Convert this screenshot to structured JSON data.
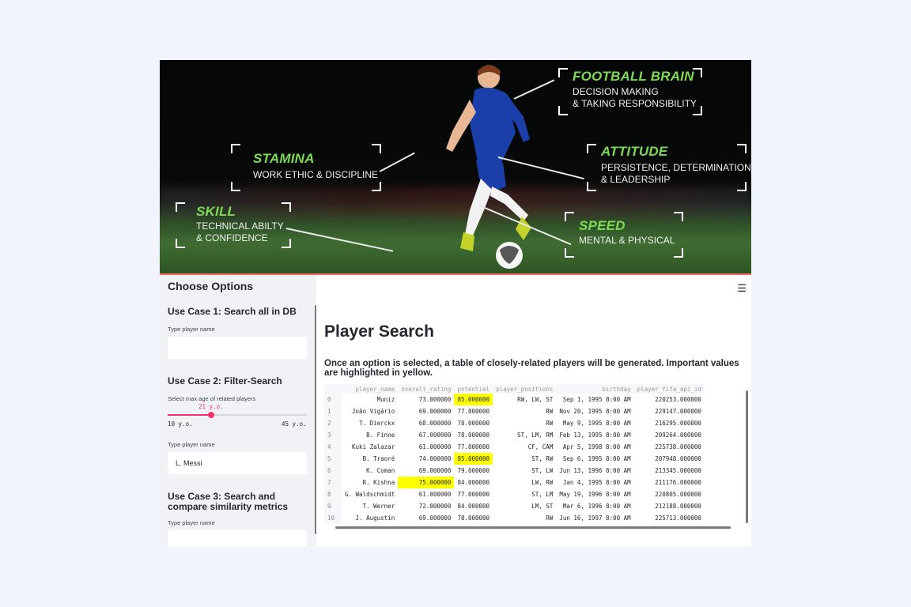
{
  "banner": {
    "features": [
      {
        "title": "FOOTBALL BRAIN",
        "lines": [
          "DECISION MAKING",
          "& TAKING RESPONSIBILITY"
        ]
      },
      {
        "title": "STAMINA",
        "lines": [
          "WORK ETHIC & DISCIPLINE"
        ]
      },
      {
        "title": "ATTITUDE",
        "lines": [
          "PERSISTENCE, DETERMINATION",
          "& LEADERSHIP"
        ]
      },
      {
        "title": "SKILL",
        "lines": [
          "TECHNICAL ABILTY",
          "& CONFIDENCE"
        ]
      },
      {
        "title": "SPEED",
        "lines": [
          "MENTAL & PHYSICAL"
        ]
      }
    ],
    "colors": {
      "accent_green": "#7ed957",
      "sidebar_bg": "#f0f2f6",
      "slider": "#f63366",
      "highlight": "#ffff00"
    }
  },
  "sidebar": {
    "title": "Choose Options",
    "case1": {
      "heading": "Use Case 1: Search all in DB",
      "label": "Type player name",
      "value": ""
    },
    "case2": {
      "heading": "Use Case 2: Filter-Search",
      "slider_label": "Select max age of related players",
      "slider_value": "21 y.o.",
      "slider_min": "10 y.o.",
      "slider_max": "45 y.o.",
      "slider_fraction": 0.31,
      "label": "Type player name",
      "value": "L. Messi"
    },
    "case3": {
      "heading_line1": "Use Case 3: Search and",
      "heading_line2": "compare similarity metrics",
      "label": "Type player name",
      "value": ""
    }
  },
  "main": {
    "menu_icon": "hamburger-icon",
    "title": "Player Search",
    "description": "Once an option is selected, a table of closely-related players will be generated. Important values are highlighted in yellow.",
    "table": {
      "columns": [
        "",
        "player_name",
        "overall_rating",
        "potential",
        "player_positions",
        "birthday",
        "player_fifa_api_id"
      ],
      "rows": [
        [
          "0",
          "Muniz",
          "73.000000",
          "85.000000",
          "RW, LW, ST",
          "Sep 1, 1995 8:00 AM",
          "220253.000000"
        ],
        [
          "1",
          "João Vigário",
          "69.000000",
          "77.000000",
          "RW",
          "Nov 20, 1995 8:00 AM",
          "229147.000000"
        ],
        [
          "2",
          "T. Dierckx",
          "68.000000",
          "78.000000",
          "RW",
          "May 9, 1995 8:00 AM",
          "216295.000000"
        ],
        [
          "3",
          "B. Finne",
          "67.000000",
          "78.000000",
          "ST, LM, RM",
          "Feb 13, 1995 8:00 AM",
          "209264.000000"
        ],
        [
          "4",
          "Kuki Zalazar",
          "61.000000",
          "77.000000",
          "CF, CAM",
          "Apr 5, 1998 8:00 AM",
          "225738.000000"
        ],
        [
          "5",
          "B. Traoré",
          "74.000000",
          "85.000000",
          "ST, RW",
          "Sep 6, 1995 8:00 AM",
          "207948.000000"
        ],
        [
          "6",
          "K. Coman",
          "69.000000",
          "79.000000",
          "ST, LW",
          "Jun 13, 1996 8:00 AM",
          "213345.000000"
        ],
        [
          "7",
          "R. Kishna",
          "75.000000",
          "84.000000",
          "LW, RW",
          "Jan 4, 1995 8:00 AM",
          "211176.000000"
        ],
        [
          "8",
          "G. Waldschmidt",
          "61.000000",
          "77.000000",
          "ST, LM",
          "May 19, 1996 8:00 AM",
          "220805.000000"
        ],
        [
          "9",
          "T. Werner",
          "72.000000",
          "84.000000",
          "LM, ST",
          "Mar 6, 1996 8:00 AM",
          "212188.000000"
        ],
        [
          "10",
          "J. Augustin",
          "69.000000",
          "78.000000",
          "RW",
          "Jun 16, 1997 8:00 AM",
          "225713.000000"
        ]
      ],
      "highlights": [
        [
          0,
          3
        ],
        [
          5,
          3
        ],
        [
          7,
          2
        ]
      ]
    }
  }
}
